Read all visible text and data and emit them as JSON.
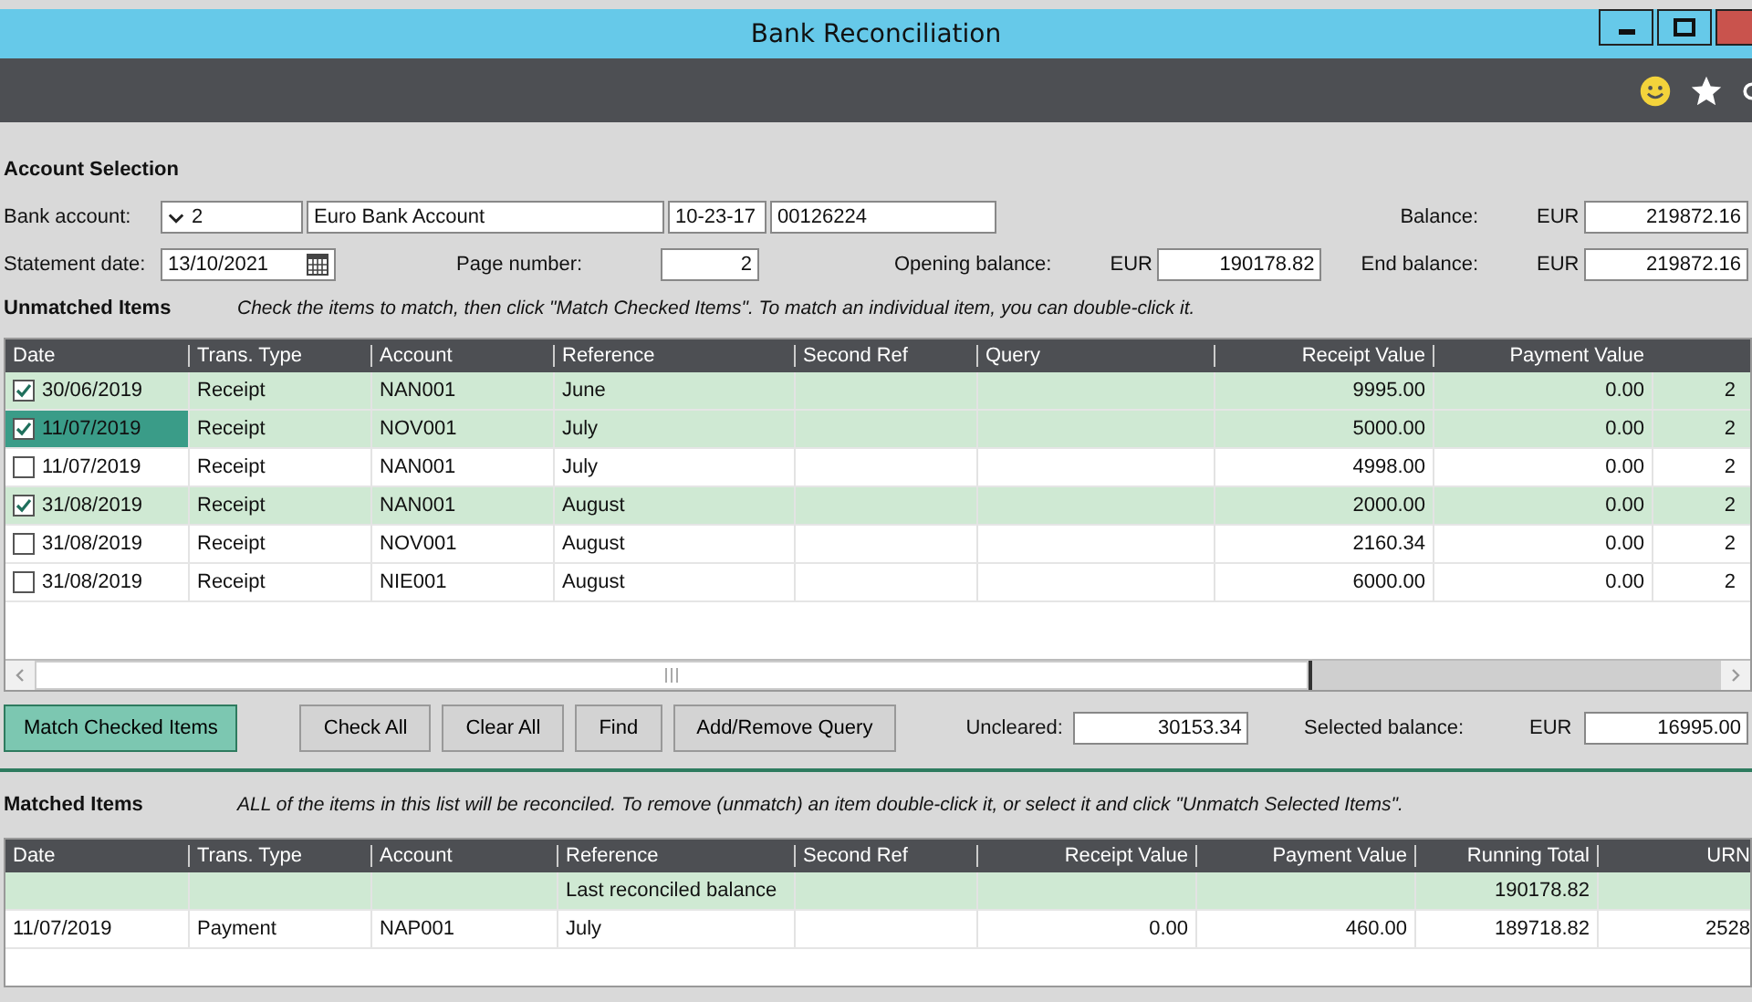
{
  "window": {
    "title": "Bank Reconciliation"
  },
  "account_selection": {
    "heading": "Account Selection",
    "bank_account": {
      "label": "Bank account:",
      "code": "2",
      "name": "Euro Bank Account",
      "sort_code": "10-23-17",
      "account_number": "00126224"
    },
    "balance": {
      "label": "Balance:",
      "currency": "EUR",
      "value": "219872.16"
    },
    "statement_date": {
      "label": "Statement date:",
      "value": "13/10/2021"
    },
    "page_number": {
      "label": "Page number:",
      "value": "2"
    },
    "opening_balance": {
      "label": "Opening balance:",
      "currency": "EUR",
      "value": "190178.82"
    },
    "end_balance": {
      "label": "End balance:",
      "currency": "EUR",
      "value": "219872.16"
    }
  },
  "unmatched": {
    "heading": "Unmatched Items",
    "hint": "Check the items to match, then click \"Match Checked Items\". To match an individual item, you can double-click it.",
    "columns": [
      "Date",
      "Trans. Type",
      "Account",
      "Reference",
      "Second Ref",
      "Query",
      "Receipt Value",
      "Payment Value"
    ],
    "rows": [
      {
        "checked": true,
        "selected": false,
        "date": "30/06/2019",
        "type": "Receipt",
        "account": "NAN001",
        "reference": "June",
        "receipt": "9995.00",
        "payment": "0.00",
        "column_9": "2"
      },
      {
        "checked": true,
        "selected": true,
        "date": "11/07/2019",
        "type": "Receipt",
        "account": "NOV001",
        "reference": "July",
        "receipt": "5000.00",
        "payment": "0.00",
        "column_9": "2"
      },
      {
        "checked": false,
        "selected": false,
        "date": "11/07/2019",
        "type": "Receipt",
        "account": "NAN001",
        "reference": "July",
        "receipt": "4998.00",
        "payment": "0.00",
        "column_9": "2"
      },
      {
        "checked": true,
        "selected": false,
        "date": "31/08/2019",
        "type": "Receipt",
        "account": "NAN001",
        "reference": "August",
        "receipt": "2000.00",
        "payment": "0.00",
        "column_9": "2"
      },
      {
        "checked": false,
        "selected": false,
        "date": "31/08/2019",
        "type": "Receipt",
        "account": "NOV001",
        "reference": "August",
        "receipt": "2160.34",
        "payment": "0.00",
        "column_9": "2"
      },
      {
        "checked": false,
        "selected": false,
        "date": "31/08/2019",
        "type": "Receipt",
        "account": "NIE001",
        "reference": "August",
        "receipt": "6000.00",
        "payment": "0.00",
        "column_9": "2"
      }
    ]
  },
  "buttons": [
    "Match Checked Items",
    "Check All",
    "Clear All",
    "Find",
    "Add/Remove Query"
  ],
  "uncleared": {
    "label": "Uncleared:",
    "value": "30153.34"
  },
  "selected_balance": {
    "label": "Selected balance:",
    "currency": "EUR",
    "value": "16995.00"
  },
  "matched": {
    "heading": "Matched Items",
    "hint": "ALL of the items in this list will be reconciled. To remove (unmatch) an item double-click it, or select it and click \"Unmatch Selected Items\".",
    "columns": [
      "Date",
      "Trans. Type",
      "Account",
      "Reference",
      "Second Ref",
      "Receipt Value",
      "Payment Value",
      "Running Total",
      "URN"
    ],
    "rows": [
      {
        "kind": "balance",
        "reference": "Last reconciled balance",
        "running_total": "190178.82"
      },
      {
        "kind": "item",
        "date": "11/07/2019",
        "type": "Payment",
        "account": "NAP001",
        "reference": "July",
        "receipt": "0.00",
        "payment": "460.00",
        "running_total": "189718.82",
        "urn": "2528"
      }
    ]
  }
}
